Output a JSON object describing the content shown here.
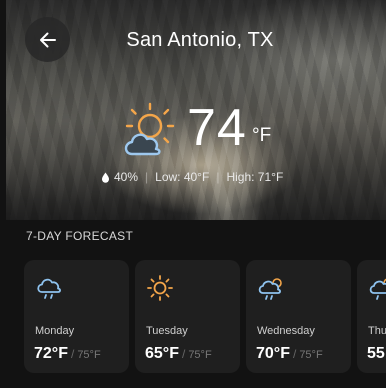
{
  "header": {
    "city": "San Antonio, TX",
    "back_icon": "arrow-left-icon"
  },
  "current": {
    "icon": "partly-cloudy-sun-icon",
    "temperature": "74",
    "unit": "°F",
    "humidity": "40%",
    "low": "Low: 40°F",
    "high": "High: 71°F",
    "accent_colors": {
      "sun": "#f4a64a",
      "cloud": "#9ec8ee"
    }
  },
  "forecast": {
    "title": "7-DAY FORECAST",
    "days": [
      {
        "day": "Monday",
        "icon": "rain-cloud-icon",
        "high": "72°F",
        "low": "75°F"
      },
      {
        "day": "Tuesday",
        "icon": "sun-icon",
        "high": "65°F",
        "low": "75°F"
      },
      {
        "day": "Wednesday",
        "icon": "cloud-sun-rain-icon",
        "high": "70°F",
        "low": "75°F"
      },
      {
        "day": "Thu",
        "icon": "cloud-sun-rain-icon",
        "high": "55"
      }
    ]
  }
}
